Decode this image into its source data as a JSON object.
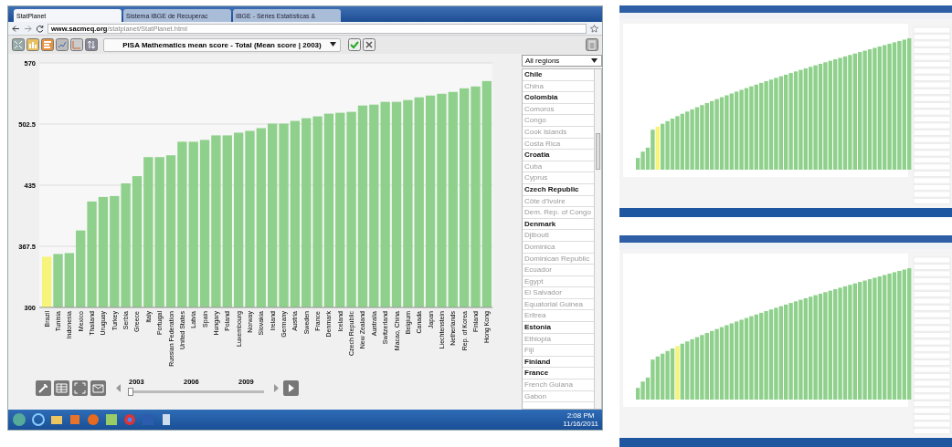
{
  "browser": {
    "tabs": [
      {
        "label": "StatPlanet",
        "selected": true
      },
      {
        "label": "Sistema IBGE de Recuperac",
        "selected": false
      },
      {
        "label": "IBGE - Séries Estatísticas &",
        "selected": false
      }
    ],
    "address": {
      "domain": "www.sacmeq.org",
      "path": "/statplanet/StatPlanet.html"
    }
  },
  "toolbar": {
    "indicator": "PISA Mathematics mean score - Total (Mean score | 2003)"
  },
  "chart": {
    "selected_bars": [
      true,
      false,
      false,
      false,
      false,
      false,
      false,
      false,
      false,
      false,
      false,
      false,
      false,
      false,
      false,
      false,
      false,
      false,
      false,
      false,
      false,
      false,
      false,
      false,
      false,
      false,
      false,
      false,
      false,
      false,
      false,
      false,
      false,
      false,
      false,
      false,
      false,
      false,
      false,
      false
    ],
    "chart_data": {
      "type": "bar",
      "grid": true,
      "categories": [
        "Brazil",
        "Tunisia",
        "Indonesia",
        "Mexico",
        "Thailand",
        "Uruguay",
        "Turkey",
        "Serbia",
        "Greece",
        "Italy",
        "Portugal",
        "Russian Federation",
        "United States",
        "Latvia",
        "Spain",
        "Hungary",
        "Poland",
        "Luxembourg",
        "Norway",
        "Slovakia",
        "Ireland",
        "Germany",
        "Austria",
        "Sweden",
        "France",
        "Denmark",
        "Iceland",
        "Czech Republic",
        "New Zealand",
        "Australia",
        "Switzerland",
        "Macao, China",
        "Belgium",
        "Canada",
        "Japan",
        "Liechtenstein",
        "Netherlands",
        "Rep. of Korea",
        "Finland",
        "Hong Kong"
      ],
      "values": [
        356,
        359,
        360,
        385,
        417,
        422,
        423,
        437,
        445,
        466,
        466,
        468,
        483,
        483,
        485,
        490,
        490,
        493,
        495,
        498,
        503,
        503,
        506,
        509,
        511,
        514,
        515,
        516,
        523,
        524,
        527,
        527,
        529,
        532,
        534,
        536,
        538,
        542,
        544,
        550
      ],
      "ylim": [
        300,
        570
      ],
      "yticks": [
        300,
        367.5,
        435,
        502.5,
        570
      ]
    }
  },
  "region_filter": {
    "value": "All regions"
  },
  "countries": [
    {
      "label": "Chile",
      "disabled": false
    },
    {
      "label": "China",
      "disabled": true
    },
    {
      "label": "Colombia",
      "disabled": false
    },
    {
      "label": "Comoros",
      "disabled": true
    },
    {
      "label": "Congo",
      "disabled": true
    },
    {
      "label": "Cook Islands",
      "disabled": true
    },
    {
      "label": "Costa Rica",
      "disabled": true
    },
    {
      "label": "Croatia",
      "disabled": false
    },
    {
      "label": "Cuba",
      "disabled": true
    },
    {
      "label": "Cyprus",
      "disabled": true
    },
    {
      "label": "Czech Republic",
      "disabled": false
    },
    {
      "label": "Côte d'Ivoire",
      "disabled": true
    },
    {
      "label": "Dem. Rep. of Congo",
      "disabled": true
    },
    {
      "label": "Denmark",
      "disabled": false
    },
    {
      "label": "Djibouti",
      "disabled": true
    },
    {
      "label": "Dominica",
      "disabled": true
    },
    {
      "label": "Dominican Republic",
      "disabled": true
    },
    {
      "label": "Ecuador",
      "disabled": true
    },
    {
      "label": "Egypt",
      "disabled": true
    },
    {
      "label": "El Salvador",
      "disabled": true
    },
    {
      "label": "Equatorial Guinea",
      "disabled": true
    },
    {
      "label": "Eritrea",
      "disabled": true
    },
    {
      "label": "Estonia",
      "disabled": false
    },
    {
      "label": "Ethiopia",
      "disabled": true
    },
    {
      "label": "Fiji",
      "disabled": true
    },
    {
      "label": "Finland",
      "disabled": false
    },
    {
      "label": "France",
      "disabled": false
    },
    {
      "label": "French Guiana",
      "disabled": true
    },
    {
      "label": "Gabon",
      "disabled": true
    }
  ],
  "timeline": {
    "years": [
      "2003",
      "2006",
      "2009"
    ],
    "level": 0
  },
  "taskbar": {
    "time": "2:08 PM",
    "date": "11/16/2011"
  }
}
